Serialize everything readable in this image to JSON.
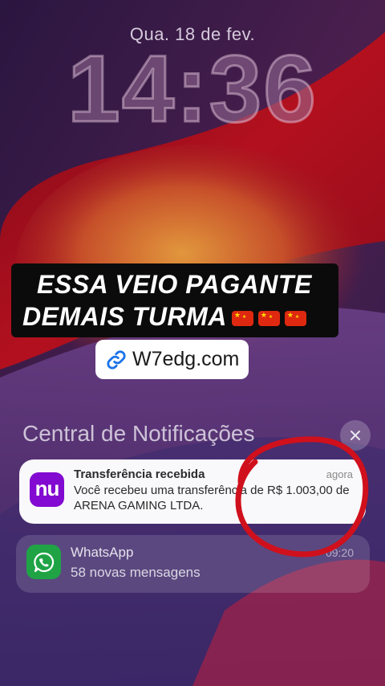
{
  "lockscreen": {
    "date": "Qua. 18 de fev.",
    "time": "14:36"
  },
  "caption": {
    "line1": "ESSA VEIO PAGANTE",
    "line2": "DEMAIS TURMA",
    "flag_count": 3,
    "flag_icon": "china-flag-icon"
  },
  "link": {
    "icon": "link-icon",
    "text": "W7edg.com"
  },
  "notification_center": {
    "title": "Central de Notificações",
    "close_icon": "close-icon"
  },
  "notifications": [
    {
      "app": "nubank",
      "icon_text": "nu",
      "title": "Transferência recebida",
      "time": "agora",
      "text": "Você recebeu uma transferência de R$ 1.003,00 de ARENA GAMING LTDA."
    },
    {
      "app": "whatsapp",
      "icon": "whatsapp-icon",
      "title": "WhatsApp",
      "time": "09:20",
      "text": "58 novas mensagens"
    }
  ],
  "colors": {
    "wallpaper_red": "#b3101e",
    "wallpaper_purple": "#3a1f57",
    "nubank_purple": "#820ad1",
    "whatsapp_green": "#1fa345",
    "annotation_red": "#d0101c"
  }
}
